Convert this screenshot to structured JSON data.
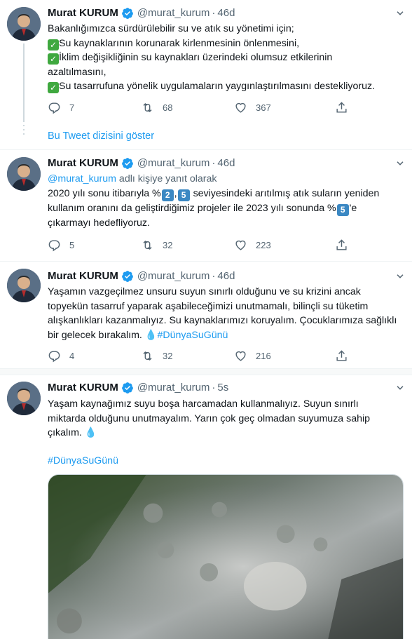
{
  "tweets": [
    {
      "name": "Murat KURUM",
      "handle": "@murat_kurum",
      "sep": "·",
      "time": "46d",
      "lines": [
        "Bakanlığımızca sürdürülebilir su ve atık su yönetimi için;",
        "Su kaynaklarının korunarak kirlenmesinin önlenmesini,",
        "İklim değişikliğinin su kaynakları üzerindeki olumsuz etkilerinin",
        "azaltılmasını,",
        "Su tasarrufuna yönelik uygulamaların yaygınlaştırılmasını destekliyoruz."
      ],
      "check": "✓",
      "replies": "7",
      "retweets": "68",
      "likes": "367"
    },
    {
      "name": "Murat KURUM",
      "handle": "@murat_kurum",
      "sep": "·",
      "time": "46d",
      "replying_handle": "@murat_kurum",
      "replying_text": " adlı kişiye yanıt olarak",
      "line1_a": "2020 yılı sonu itibarıyla %",
      "line1_k1": "2",
      "line1_comma": ",",
      "line1_k2": "5",
      "line1_b": " seviyesindeki arıtılmış atık suların yeniden",
      "line2": "kullanım oranını da geliştirdiğimiz projeler ile 2023 yılı sonunda %",
      "line2_k": "5",
      "line2_b": "'e",
      "line3": "çıkarmayı hedefliyoruz.",
      "replies": "5",
      "retweets": "32",
      "likes": "223"
    },
    {
      "name": "Murat KURUM",
      "handle": "@murat_kurum",
      "sep": "·",
      "time": "46d",
      "lines": [
        "Yaşamın vazgeçilmez unsuru suyun sınırlı olduğunu ve su krizini ancak",
        "topyekün tasarruf yaparak aşabileceğimizi unutmamalı, bilinçli su tüketim",
        "alışkanlıkları kazanmalıyız. Su kaynaklarımızı koruyalım. Çocuklarımıza sağlıklı"
      ],
      "last_line": "bir gelecek bırakalım. ",
      "drop": "💧",
      "hashtag": "#DünyaSuGünü",
      "replies": "4",
      "retweets": "32",
      "likes": "216"
    },
    {
      "name": "Murat KURUM",
      "handle": "@murat_kurum",
      "sep": "·",
      "time": "5s",
      "lines": [
        "Yaşam kaynağımız suyu boşa harcamadan kullanmalıyız. Suyun sınırlı",
        "miktarda olduğunu unutmayalım. Yarın çok geç olmadan suyumuza sahip"
      ],
      "last_line": "çıkalım. ",
      "drop": "💧",
      "hashtag": "#DünyaSuGünü"
    }
  ],
  "show_thread": "Bu Tweet dizisini göster",
  "colors": {
    "accent": "#1d9bf0",
    "secondary": "#536471",
    "check": "#3fa83f",
    "keycap": "#3b88c3"
  }
}
